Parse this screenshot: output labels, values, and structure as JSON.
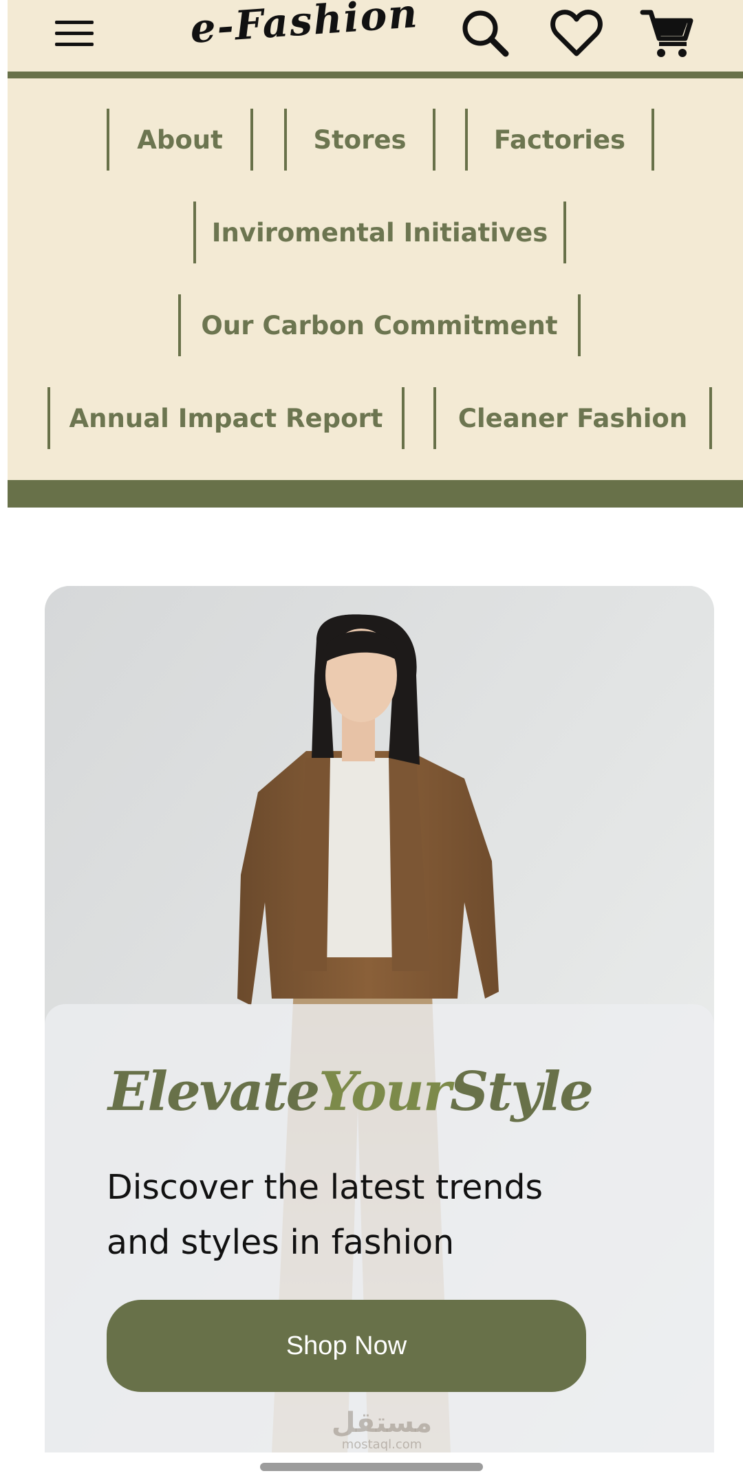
{
  "header": {
    "logo": "e-Fashion",
    "menu_icon": "hamburger-menu-icon",
    "search_icon": "search-icon",
    "wishlist_icon": "heart-icon",
    "cart_icon": "shopping-cart-icon"
  },
  "nav": {
    "items": [
      {
        "label": "About"
      },
      {
        "label": "Stores"
      },
      {
        "label": "Factories"
      },
      {
        "label": "Inviromental Initiatives"
      },
      {
        "label": "Our Carbon Commitment"
      },
      {
        "label": "Annual Impact Report"
      },
      {
        "label": "Cleaner Fashion"
      }
    ]
  },
  "hero": {
    "title_word_1": "Elevate",
    "title_word_2": "Your",
    "title_word_3": "Style",
    "subtitle": "Discover the latest trends and styles in fashion",
    "cta_label": "Shop Now",
    "watermark_arabic": "مستقل",
    "watermark_latin": "mostaql.com"
  },
  "colors": {
    "accent_olive": "#687149",
    "header_bg": "#f3ead4",
    "nav_text": "#6c7550"
  }
}
